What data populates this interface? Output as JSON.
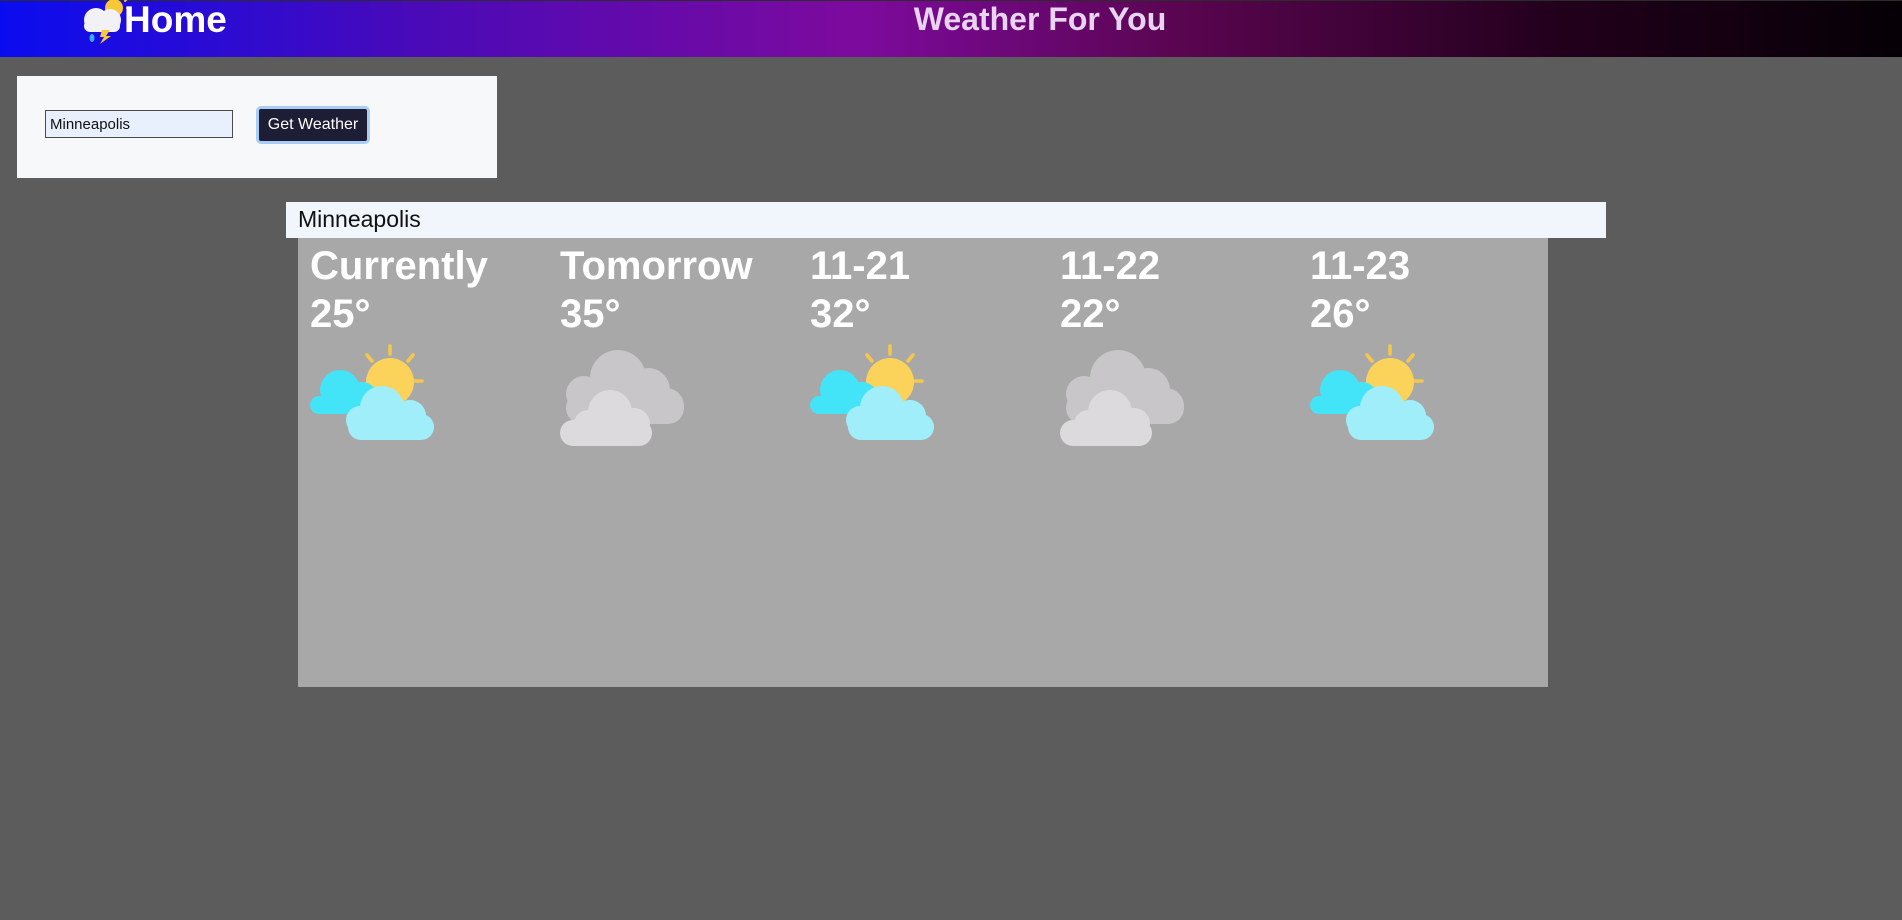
{
  "navbar": {
    "brand_label": "Home",
    "brand_icon": "storm-cloud-icon",
    "site_title": "Weather For You",
    "colors": {
      "gradient_start": "#0a0cf0",
      "gradient_mid": "#7d0a9e",
      "gradient_end": "#050005"
    }
  },
  "search": {
    "input_value": "Minneapolis",
    "button_label": "Get Weather"
  },
  "location": {
    "city": "Minneapolis"
  },
  "forecast": {
    "days": [
      {
        "label": "Currently",
        "temp": "25°",
        "icon": "partly-sunny-icon"
      },
      {
        "label": "Tomorrow",
        "temp": "35°",
        "icon": "cloudy-icon"
      },
      {
        "label": "11-21",
        "temp": "32°",
        "icon": "partly-sunny-icon"
      },
      {
        "label": "11-22",
        "temp": "22°",
        "icon": "cloudy-icon"
      },
      {
        "label": "11-23",
        "temp": "26°",
        "icon": "partly-sunny-icon"
      }
    ]
  }
}
